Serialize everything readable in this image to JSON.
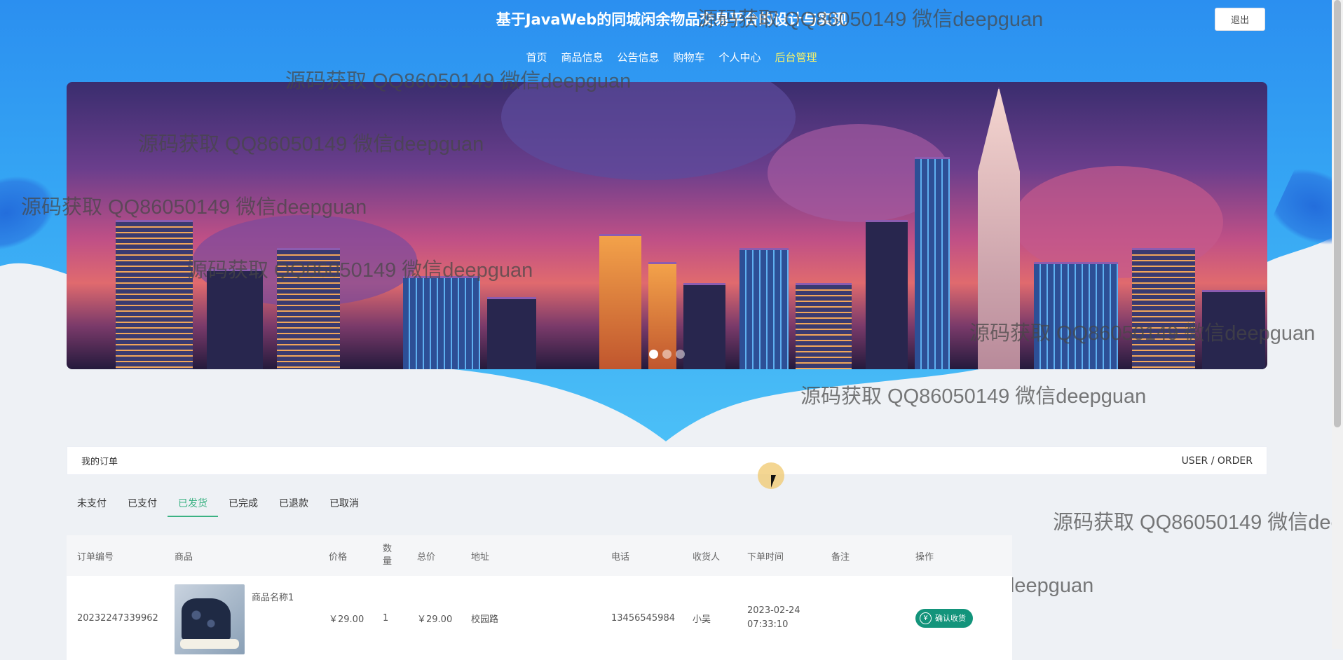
{
  "header": {
    "site_title": "基于JavaWeb的同城闲余物品交易平台的设计与实现",
    "logout_label": "退出"
  },
  "nav": {
    "items": [
      "首页",
      "商品信息",
      "公告信息",
      "购物车",
      "个人中心",
      "后台管理"
    ],
    "active_index": 5,
    "active_color": "#f5f26b"
  },
  "banner": {
    "slide_count": 3,
    "active_slide": 0
  },
  "watermark_text": "源码获取 QQ86050149 微信deepguan",
  "order_section": {
    "title": "我的订单",
    "breadcrumb": "USER / ORDER"
  },
  "tabs": {
    "items": [
      "未支付",
      "已支付",
      "已发货",
      "已完成",
      "已退款",
      "已取消"
    ],
    "active_index": 2,
    "active_color": "#3bb283"
  },
  "table": {
    "headers": [
      "订单编号",
      "商品",
      "价格",
      "数量",
      "总价",
      "地址",
      "电话",
      "收货人",
      "下单时间",
      "备注",
      "操作"
    ],
    "rows": [
      {
        "order_no": "20232247339962",
        "goods_name": "商品名称1",
        "price": "￥29.00",
        "quantity": "1",
        "total": "￥29.00",
        "address": "校园路",
        "phone": "13456545984",
        "receiver": "小吴",
        "order_time": "2023-02-24 07:33:10",
        "remark": "",
        "action_label": "确认收货",
        "action_icon": "yen-icon"
      }
    ]
  },
  "colors": {
    "header_gradient_top": "#2b8ff0",
    "confirm_button": "#13947b"
  }
}
